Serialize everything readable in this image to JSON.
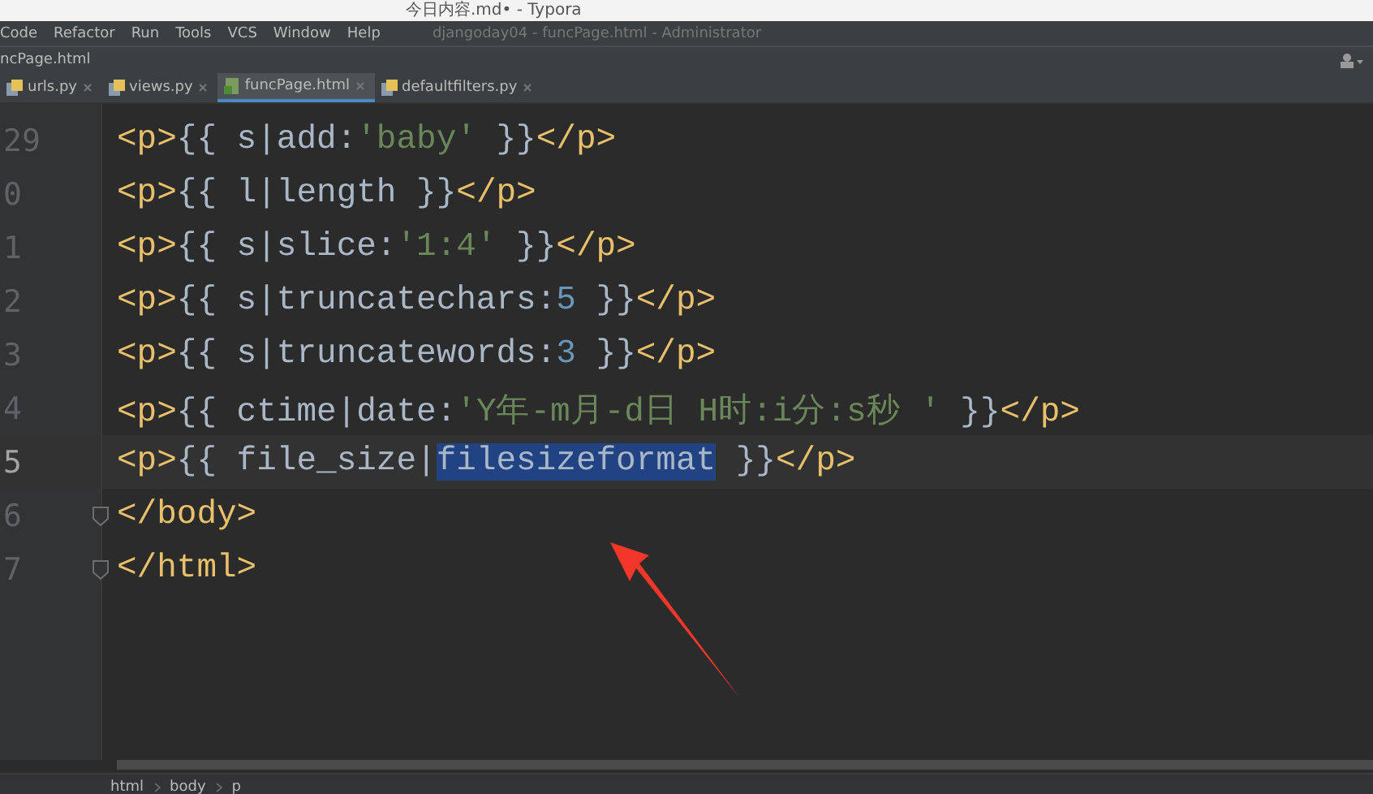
{
  "top_window": {
    "title": "今日内容.md• - Typora"
  },
  "menu": [
    "Code",
    "Refactor",
    "Run",
    "Tools",
    "VCS",
    "Window",
    "Help"
  ],
  "window": {
    "title": "djangoday04 - funcPage.html - Administrator"
  },
  "nav_path": "ncPage.html",
  "tabs": [
    {
      "label": "urls.py",
      "selected": false,
      "kind": "python"
    },
    {
      "label": "views.py",
      "selected": false,
      "kind": "python"
    },
    {
      "label": "funcPage.html",
      "selected": true,
      "kind": "html"
    },
    {
      "label": "defaultfilters.py",
      "selected": false,
      "kind": "python"
    }
  ],
  "editor": {
    "lines": [
      {
        "number": "29",
        "current": false,
        "fold": false,
        "tokens": [
          {
            "kind": "tag",
            "text": "<p>"
          },
          {
            "kind": "brace",
            "text": "{{ s|add:"
          },
          {
            "kind": "string",
            "text": "'baby'"
          },
          {
            "kind": "brace",
            "text": " }}"
          },
          {
            "kind": "tag",
            "text": "</p>"
          }
        ]
      },
      {
        "number": "0",
        "current": false,
        "fold": false,
        "tokens": [
          {
            "kind": "tag",
            "text": "<p>"
          },
          {
            "kind": "brace",
            "text": "{{ l|length }}"
          },
          {
            "kind": "tag",
            "text": "</p>"
          }
        ]
      },
      {
        "number": "1",
        "current": false,
        "fold": false,
        "tokens": [
          {
            "kind": "tag",
            "text": "<p>"
          },
          {
            "kind": "brace",
            "text": "{{ s|slice:"
          },
          {
            "kind": "string",
            "text": "'1:4'"
          },
          {
            "kind": "brace",
            "text": " }}"
          },
          {
            "kind": "tag",
            "text": "</p>"
          }
        ]
      },
      {
        "number": "2",
        "current": false,
        "fold": false,
        "tokens": [
          {
            "kind": "tag",
            "text": "<p>"
          },
          {
            "kind": "brace",
            "text": "{{ s|truncatechars:"
          },
          {
            "kind": "number",
            "text": "5"
          },
          {
            "kind": "brace",
            "text": " }}"
          },
          {
            "kind": "tag",
            "text": "</p>"
          }
        ]
      },
      {
        "number": "3",
        "current": false,
        "fold": false,
        "tokens": [
          {
            "kind": "tag",
            "text": "<p>"
          },
          {
            "kind": "brace",
            "text": "{{ s|truncatewords:"
          },
          {
            "kind": "number",
            "text": "3"
          },
          {
            "kind": "brace",
            "text": " }}"
          },
          {
            "kind": "tag",
            "text": "</p>"
          }
        ]
      },
      {
        "number": "4",
        "current": false,
        "fold": false,
        "tokens": [
          {
            "kind": "tag",
            "text": "<p>"
          },
          {
            "kind": "brace",
            "text": "{{ ctime|date:"
          },
          {
            "kind": "string",
            "text": "'Y年-m月-d日 H时:i分:s秒 '"
          },
          {
            "kind": "brace",
            "text": " }}"
          },
          {
            "kind": "tag",
            "text": "</p>"
          }
        ]
      },
      {
        "number": "5",
        "current": true,
        "fold": false,
        "tokens": [
          {
            "kind": "tag",
            "text": "<p>"
          },
          {
            "kind": "brace",
            "text": "{{ file_size|"
          },
          {
            "kind": "selected",
            "text": "filesizeformat"
          },
          {
            "kind": "brace",
            "text": " }}"
          },
          {
            "kind": "tag",
            "text": "</p>"
          }
        ]
      },
      {
        "number": "6",
        "current": false,
        "fold": true,
        "tokens": [
          {
            "kind": "tag",
            "text": "</body>"
          }
        ]
      },
      {
        "number": "7",
        "current": false,
        "fold": true,
        "tokens": [
          {
            "kind": "tag",
            "text": "</html>"
          }
        ]
      }
    ]
  },
  "breadcrumbs": [
    "html",
    "body",
    "p"
  ]
}
